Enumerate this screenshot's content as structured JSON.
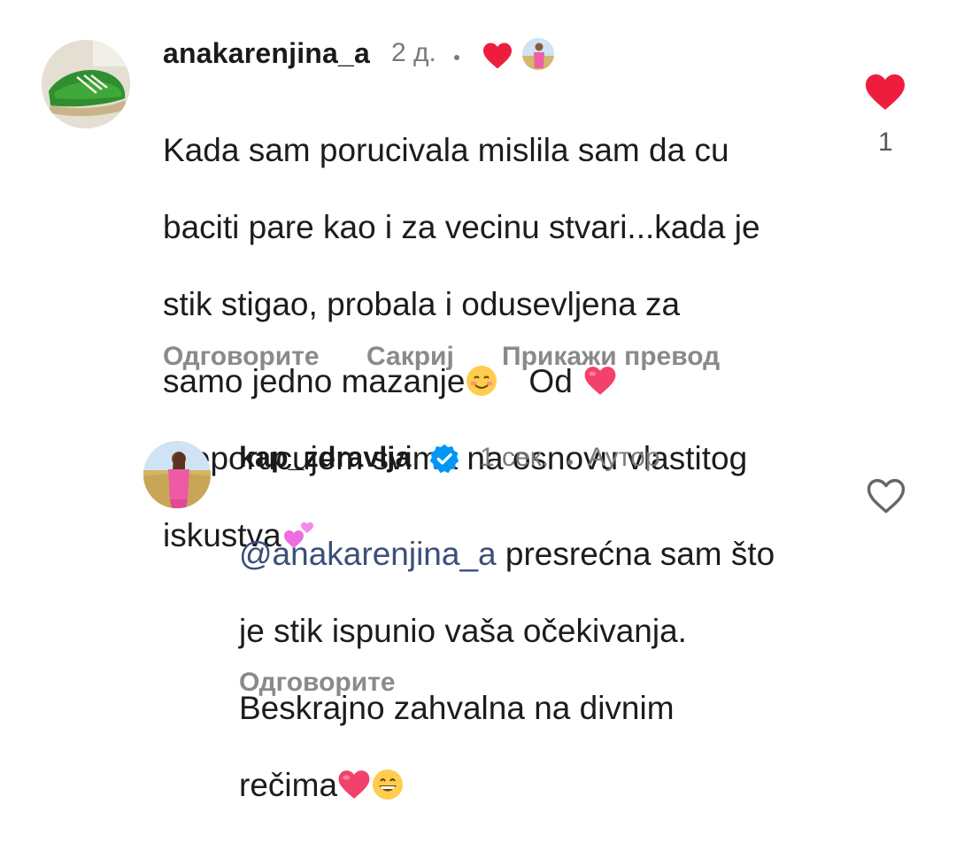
{
  "comments": [
    {
      "username": "anakarenjina_a",
      "time": "2 д.",
      "text_lines": [
        "Kada sam porucivala mislila sam da cu",
        "baciti pare kao i za vecinu stvari...kada je",
        "stik stigao, probala i odusevljena za",
        "samo jedno mazanje",
        "Od",
        "preporucujem svima na osnovu vlastitog",
        "iskustva"
      ],
      "like_count": "1",
      "liked": true,
      "actions": {
        "reply": "Одговорите",
        "hide": "Сакриј",
        "translate": "Прикажи превод"
      },
      "icons": {
        "creator_like": "red-heart-icon",
        "creator_avatar": "creator-mini-avatar",
        "like": "filled-heart-icon"
      }
    },
    {
      "username": "kap_zdravlja",
      "verified": true,
      "time": "1 сек.",
      "role": "Аутор",
      "mention": "@anakarenjina_a",
      "text_lines": [
        "presrećna sam što",
        "je stik ispunio vaša očekivanja.",
        "Beskrajno zahvalna na divnim",
        "rečima"
      ],
      "liked": false,
      "actions": {
        "reply": "Одговорите"
      },
      "icons": {
        "verified": "verified-badge-icon",
        "like": "outline-heart-icon"
      }
    }
  ],
  "colors": {
    "heart_red": "#ee1d3d",
    "verified_blue": "#0095f6",
    "secondary_text": "#7a7a7a",
    "action_text": "#8a8a8a"
  }
}
